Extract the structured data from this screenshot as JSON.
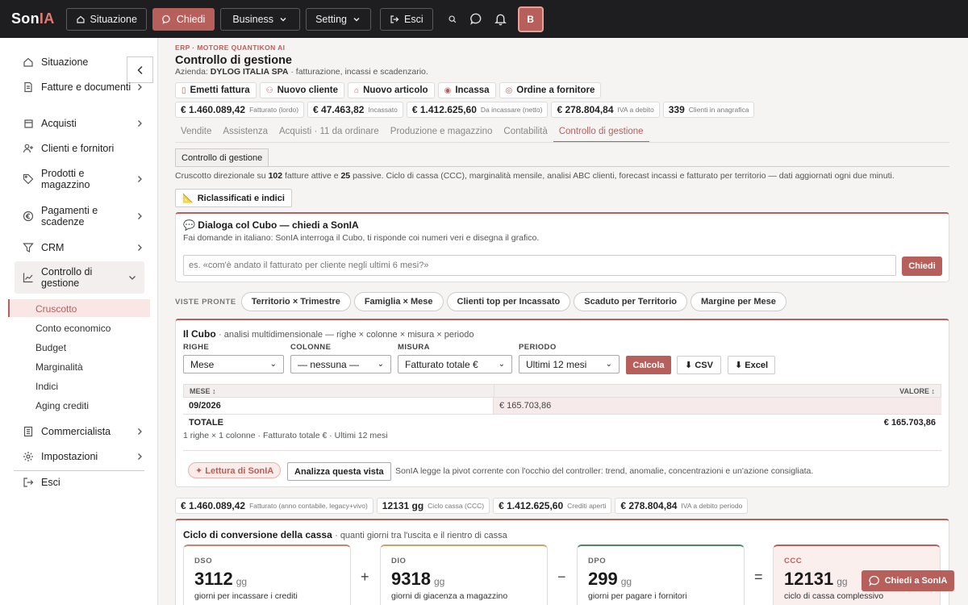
{
  "topbar": {
    "logo_main": "Son",
    "logo_accent": "IA",
    "situazione": "Situazione",
    "chiedi": "Chiedi",
    "business": "Business",
    "setting": "Setting",
    "esci": "Esci",
    "avatar": "B"
  },
  "sidebar": {
    "items": [
      {
        "label": "Situazione"
      },
      {
        "label": "Fatture e documenti"
      },
      {
        "label": "Acquisti"
      },
      {
        "label": "Clienti e fornitori"
      },
      {
        "label": "Prodotti e magazzino"
      },
      {
        "label": "Pagamenti e scadenze"
      },
      {
        "label": "CRM"
      },
      {
        "label": "Controllo di gestione"
      },
      {
        "label": "Commercialista"
      },
      {
        "label": "Impostazioni"
      },
      {
        "label": "Esci"
      }
    ],
    "subitems": [
      "Cruscotto",
      "Conto economico",
      "Budget",
      "Marginalità",
      "Indici",
      "Aging crediti"
    ]
  },
  "header": {
    "breadcrumb": "ERP · MOTORE QUANTIKON AI",
    "title": "Controllo di gestione",
    "azienda_label": "Azienda:",
    "azienda": "DYLOG ITALIA SPA",
    "azienda_desc": "· fatturazione, incassi e scadenzario."
  },
  "actions": [
    "Emetti fattura",
    "Nuovo cliente",
    "Nuovo articolo",
    "Incassa",
    "Ordine a fornitore"
  ],
  "kpis": [
    {
      "value": "€ 1.460.089,42",
      "label": "Fatturato (lordo)"
    },
    {
      "value": "€ 47.463,82",
      "label": "Incassato"
    },
    {
      "value": "€ 1.412.625,60",
      "label": "Da incassare (netto)"
    },
    {
      "value": "€ 278.804,84",
      "label": "IVA a debito"
    },
    {
      "value": "339",
      "label": "Clienti in anagrafica"
    }
  ],
  "tabs": [
    "Vendite",
    "Assistenza",
    "Acquisti · 11 da ordinare",
    "Produzione e magazzino",
    "Contabilità",
    "Controllo di gestione"
  ],
  "subtab": "Controllo di gestione",
  "description": {
    "pre": "Cruscotto direzionale su ",
    "attive": "102",
    "mid": " fatture attive e ",
    "passive": "25",
    "post": " passive. Ciclo di cassa (CCC), marginalità mensile, analisi ABC clienti, forecast incassi e fatturato per territorio — dati aggiornati ogni due minuti."
  },
  "riclassificati": "Riclassificati e indici",
  "dialog": {
    "title": "Dialoga col Cubo — chiedi a SonIA",
    "subtitle": "Fai domande in italiano: SonIA interroga il Cubo, ti risponde coi numeri veri e disegna il grafico.",
    "placeholder": "es. «com'è andato il fatturato per cliente negli ultimi 6 mesi?»",
    "button": "Chiedi"
  },
  "viste": {
    "label": "VISTE PRONTE",
    "items": [
      "Territorio × Trimestre",
      "Famiglia × Mese",
      "Clienti top per Incassato",
      "Scaduto per Territorio",
      "Margine per Mese"
    ]
  },
  "cubo": {
    "title": "Il Cubo",
    "subtitle": "· analisi multidimensionale — righe × colonne × misura × periodo",
    "righe_label": "RIGHE",
    "righe": "Mese",
    "colonne_label": "COLONNE",
    "colonne": "— nessuna —",
    "misura_label": "MISURA",
    "misura": "Fatturato totale €",
    "periodo_label": "PERIODO",
    "periodo": "Ultimi 12 mesi",
    "calcola": "Calcola",
    "csv": "⬇ CSV",
    "excel": "⬇ Excel",
    "table": {
      "headers": [
        "MESE ↕",
        "VALORE ↕"
      ],
      "rows": [
        [
          "09/2026",
          "€ 165.703,86"
        ]
      ],
      "total": [
        "TOTALE",
        "€ 165.703,86"
      ]
    },
    "note": "1 righe × 1 colonne · Fatturato totale € · Ultimi 12 mesi",
    "lettura": "✦ Lettura di SonIA",
    "analizza": "Analizza questa vista",
    "analizza_note": "SonIA legge la pivot corrente con l'occhio del controller: trend, anomalie, concentrazioni e un'azione consigliata."
  },
  "kpis2": [
    {
      "value": "€ 1.460.089,42",
      "label": "Fatturato (anno contabile, legacy+vivo)"
    },
    {
      "value": "12131 gg",
      "label": "Ciclo cassa (CCC)"
    },
    {
      "value": "€ 1.412.625,60",
      "label": "Crediti aperti"
    },
    {
      "value": "€ 278.804,84",
      "label": "IVA a debito periodo"
    }
  ],
  "ciclo": {
    "title": "Ciclo di conversione della cassa",
    "subtitle": "· quanti giorni tra l'uscita e il rientro di cassa",
    "cards": [
      {
        "label": "DSO",
        "value": "3112",
        "unit": "gg",
        "desc": "giorni per incassare i crediti",
        "color": "#c9826f"
      },
      {
        "label": "DIO",
        "value": "9318",
        "unit": "gg",
        "desc": "giorni di giacenza a magazzino",
        "color": "#c9a466"
      },
      {
        "label": "DPO",
        "value": "299",
        "unit": "gg",
        "desc": "giorni per pagare i fornitori",
        "color": "#4c8a5e"
      },
      {
        "label": "CCC",
        "value": "12131",
        "unit": "gg",
        "desc": "ciclo di cassa complessivo",
        "color": "#b75f5a"
      }
    ],
    "ops": [
      "+",
      "−",
      "="
    ]
  },
  "float_button": "Chiedi a SonIA"
}
